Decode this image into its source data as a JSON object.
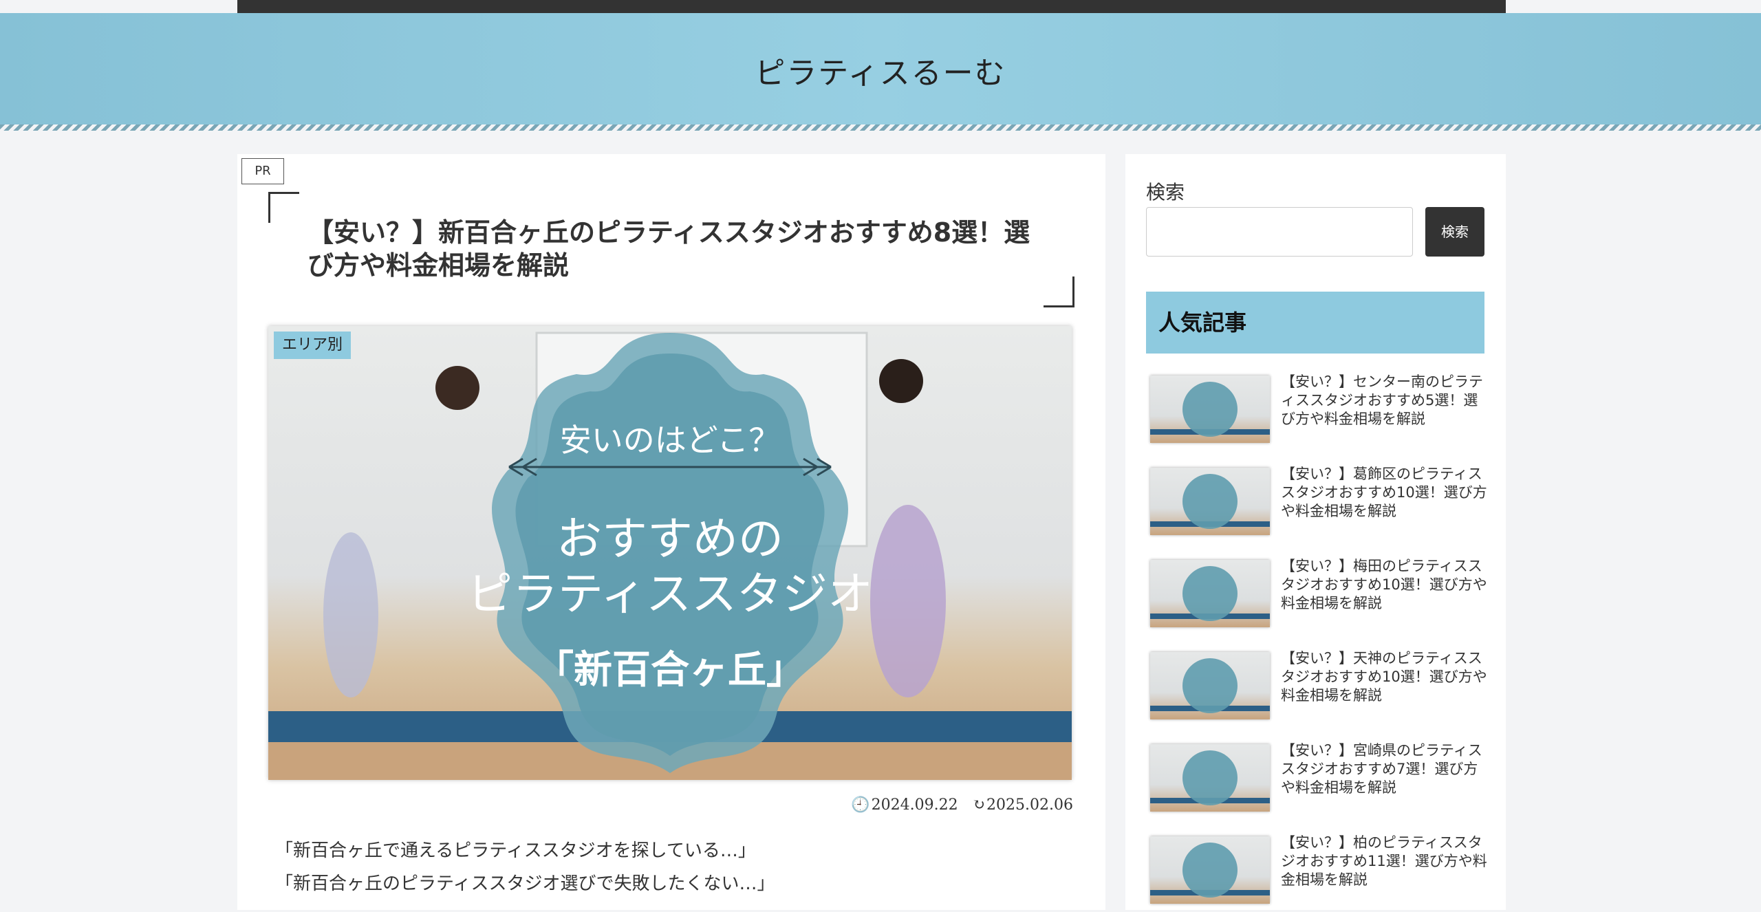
{
  "site": {
    "title": "ピラティスるーむ"
  },
  "article": {
    "pr_label": "PR",
    "title": "【安い？】新百合ヶ丘のピラティススタジオおすすめ8選！選び方や料金相場を解説",
    "category": "エリア別",
    "hero": {
      "line1": "安いのはどこ？",
      "line2": "おすすめの",
      "line3": "ピラティススタジオ",
      "line4": "「新百合ヶ丘」"
    },
    "published": "2024.09.22",
    "updated": "2025.02.06",
    "intro": [
      "「新百合ヶ丘で通えるピラティススタジオを探している…」",
      "「新百合ヶ丘のピラティススタジオ選びで失敗したくない…」"
    ]
  },
  "sidebar": {
    "search_label": "検索",
    "search_button": "検索",
    "search_value": "",
    "popular_heading": "人気記事",
    "popular": [
      {
        "title": "【安い？】センター南のピラティススタジオおすすめ5選！選び方や料金相場を解説"
      },
      {
        "title": "【安い？】葛飾区のピラティススタジオおすすめ10選！選び方や料金相場を解説"
      },
      {
        "title": "【安い？】梅田のピラティススタジオおすすめ10選！選び方や料金相場を解説"
      },
      {
        "title": "【安い？】天神のピラティススタジオおすすめ10選！選び方や料金相場を解説"
      },
      {
        "title": "【安い？】宮崎県のピラティススタジオおすすめ7選！選び方や料金相場を解説"
      },
      {
        "title": "【安い？】柏のピラティススタジオおすすめ11選！選び方や料金相場を解説"
      }
    ]
  },
  "colors": {
    "accent": "#8ecadf",
    "header": "#93cbdf",
    "dark": "#333333"
  }
}
